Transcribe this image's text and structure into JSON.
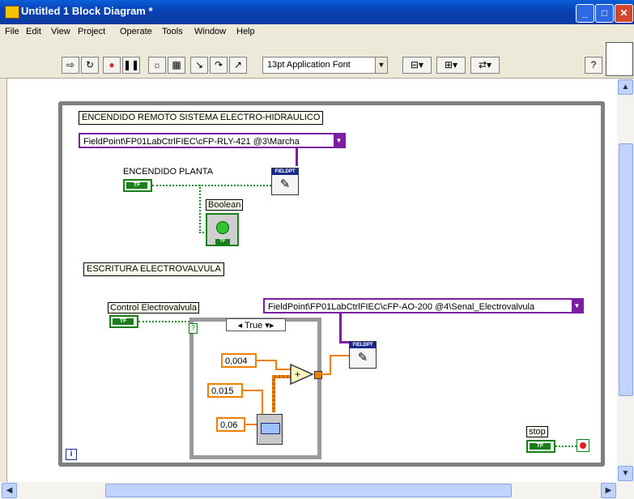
{
  "window": {
    "title": "Untitled 1 Block Diagram *"
  },
  "menu": [
    "File",
    "Edit",
    "View",
    "Project",
    "Operate",
    "Tools",
    "Window",
    "Help"
  ],
  "toolbar": {
    "font": "13pt Application Font"
  },
  "diagram": {
    "label_remote": "ENCENDIDO REMOTO SISTEMA ELECTRO-HIDRAULICO",
    "io_relay": "FieldPoint\\FP01LabCtrlFIEC\\cFP-RLY-421 @3\\Marcha",
    "label_planta": "ENCENDIDO PLANTA",
    "tf": "TF",
    "label_boolean": "Boolean",
    "fieldpt": "FIELDPT",
    "label_escritura": "ESCRITURA ELECTROVALVULA",
    "label_control": "Control Electrovalvula",
    "io_ao": "FieldPoint\\FP01LabCtrlFIEC\\cFP-AO-200 @4\\Senal_Electrovalvula",
    "case_selector": "True",
    "const1": "0,004",
    "const2": "0,015",
    "const3": "0,06",
    "label_stop": "stop",
    "case_q": "?",
    "loop_i": "i"
  }
}
